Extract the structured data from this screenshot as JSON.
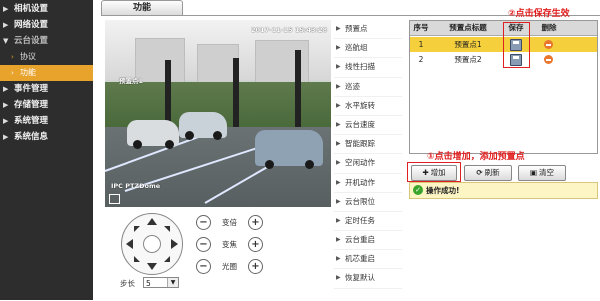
{
  "sidebar": {
    "items": [
      {
        "label": "相机设置"
      },
      {
        "label": "网络设置"
      },
      {
        "label": "云台设置"
      },
      {
        "label": "协议"
      },
      {
        "label": "功能"
      },
      {
        "label": "事件管理"
      },
      {
        "label": "存储管理"
      },
      {
        "label": "系统管理"
      },
      {
        "label": "系统信息"
      }
    ]
  },
  "tab": {
    "label": "功能"
  },
  "video": {
    "timestamp": "2017-11-15 15:43:28",
    "preset_overlay": "预置点1",
    "camera_name": "IPC PTZDome"
  },
  "menu": {
    "items": [
      "预置点",
      "巡航组",
      "线性扫描",
      "巡迹",
      "水平旋转",
      "云台速度",
      "智能跟踪",
      "空闲动作",
      "开机动作",
      "云台限位",
      "定时任务",
      "云台重启",
      "机芯重启",
      "恢复默认"
    ]
  },
  "table": {
    "headers": {
      "no": "序号",
      "title": "预置点标题",
      "save": "保存",
      "delete": "删除"
    },
    "rows": [
      {
        "no": "1",
        "title": "预置点1"
      },
      {
        "no": "2",
        "title": "预置点2"
      }
    ]
  },
  "annotations": {
    "save_hint": "②点击保存生效",
    "add_hint": "①点击增加，添加预置点"
  },
  "buttons": {
    "add": "增加",
    "refresh": "刷新",
    "clear": "清空"
  },
  "status": {
    "text": "操作成功!"
  },
  "ptz": {
    "zoom": "变倍",
    "focus": "变焦",
    "iris": "光圈",
    "step_label": "步长",
    "step_value": "5"
  }
}
